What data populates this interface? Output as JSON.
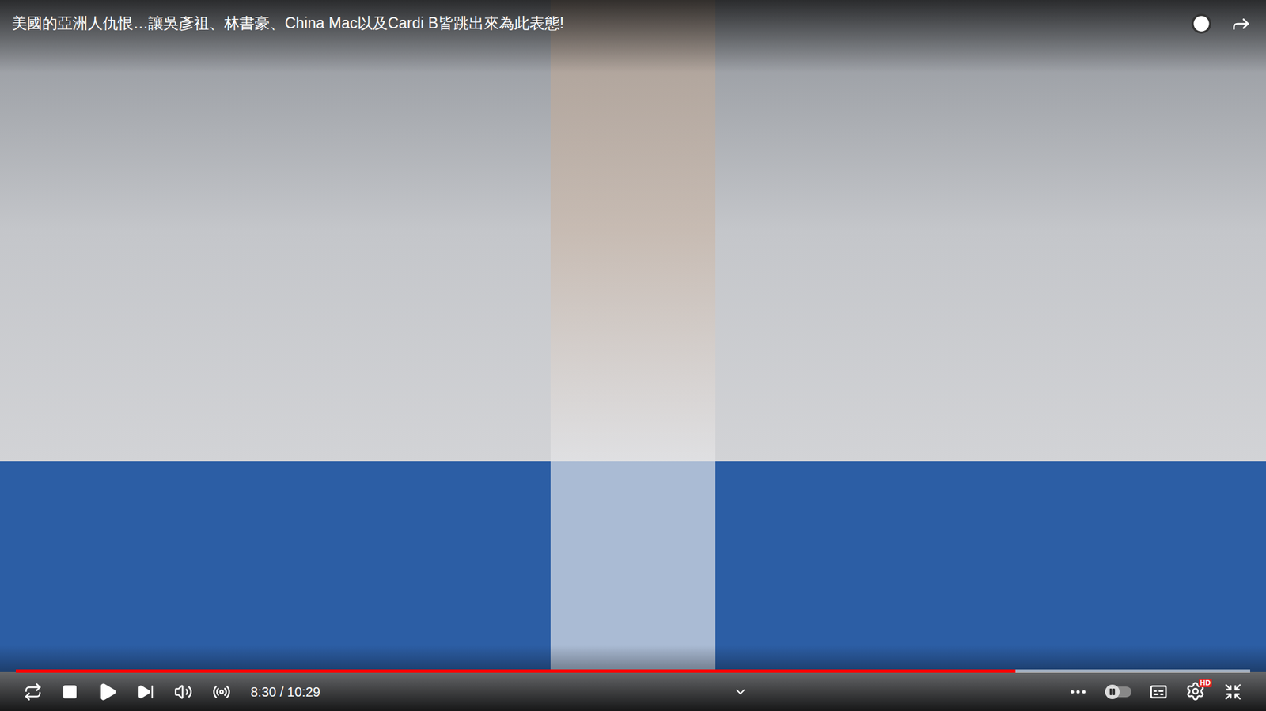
{
  "window": {
    "title": "美國的亞洲人仇恨…讓吳彥祖、林書豪、China Mac以及Cardi B皆跳出來為此表態!"
  },
  "player": {
    "time": "8:30 / 10:29",
    "progress": {
      "level": 0.81
    },
    "autoplay": {
      "on": false
    },
    "quality_badge": "HD"
  }
}
